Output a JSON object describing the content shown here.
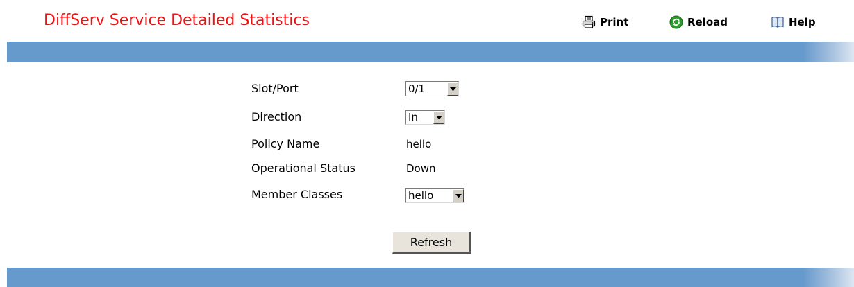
{
  "header": {
    "title": "DiffServ Service Detailed Statistics",
    "toolbar": {
      "print_label": "Print",
      "reload_label": "Reload",
      "help_label": "Help"
    }
  },
  "form": {
    "slot_port": {
      "label": "Slot/Port",
      "value": "0/1"
    },
    "direction": {
      "label": "Direction",
      "value": "In"
    },
    "policy_name": {
      "label": "Policy Name",
      "value": "hello"
    },
    "operational_status": {
      "label": "Operational Status",
      "value": "Down"
    },
    "member_classes": {
      "label": "Member Classes",
      "value": "hello"
    },
    "refresh_label": "Refresh"
  },
  "colors": {
    "title": "#ee1111",
    "band": "#6699cc",
    "reload_icon": "#2e9a2e"
  },
  "icons": {
    "print": "printer-icon",
    "reload": "reload-icon",
    "help": "help-book-icon",
    "dropdown": "chevron-down-icon"
  }
}
